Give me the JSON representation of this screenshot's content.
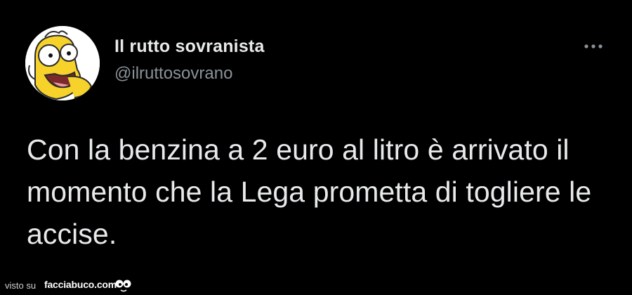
{
  "tweet": {
    "display_name": "Il rutto sovranista",
    "handle": "@ilruttosovrano",
    "text": "Con la benzina a 2 euro al litro è arrivato il momento che la Lega prometta di togliere le accise.",
    "more_icon": "more-horizontal-icon"
  },
  "footer": {
    "visto_label": "visto su",
    "brand": "facciabuco.com",
    "logo_icon": "eyes-logo-icon"
  },
  "colors": {
    "background": "#000000",
    "primary_text": "#e7e9ea",
    "secondary_text": "#8b9298"
  }
}
